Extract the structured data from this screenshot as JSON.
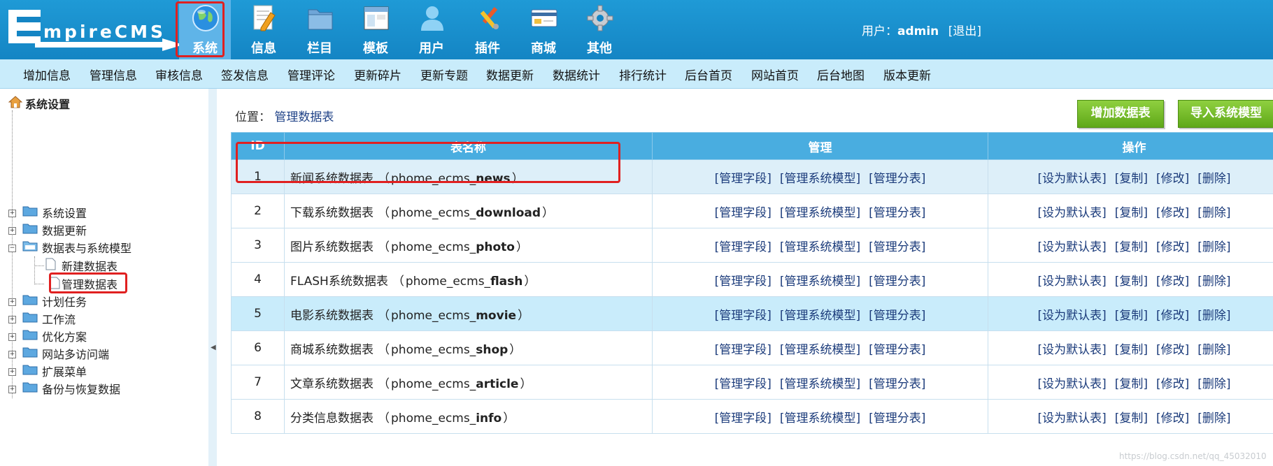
{
  "header": {
    "logo_text": "EmpireCMS",
    "nav": [
      {
        "label": "系统",
        "icon": "globe-icon",
        "active": true
      },
      {
        "label": "信息",
        "icon": "document-pen-icon"
      },
      {
        "label": "栏目",
        "icon": "folder-icon"
      },
      {
        "label": "模板",
        "icon": "window-template-icon"
      },
      {
        "label": "用户",
        "icon": "user-icon"
      },
      {
        "label": "插件",
        "icon": "plugin-tools-icon"
      },
      {
        "label": "商城",
        "icon": "card-shop-icon"
      },
      {
        "label": "其他",
        "icon": "gear-icon"
      }
    ],
    "user_label": "用户：",
    "username": "admin",
    "logout": "[退出]"
  },
  "subnav": [
    "增加信息",
    "管理信息",
    "审核信息",
    "签发信息",
    "管理评论",
    "更新碎片",
    "更新专题",
    "数据更新",
    "数据统计",
    "排行统计",
    "后台首页",
    "网站首页",
    "后台地图",
    "版本更新"
  ],
  "sidebar": {
    "root": "系统设置",
    "items": [
      {
        "label": "系统设置"
      },
      {
        "label": "数据更新"
      },
      {
        "label": "数据表与系统模型",
        "expanded": true,
        "children": [
          {
            "label": "新建数据表"
          },
          {
            "label": "管理数据表",
            "selected": true
          }
        ]
      },
      {
        "label": "计划任务"
      },
      {
        "label": "工作流"
      },
      {
        "label": "优化方案"
      },
      {
        "label": "网站多访问端"
      },
      {
        "label": "扩展菜单"
      },
      {
        "label": "备份与恢复数据"
      }
    ]
  },
  "main": {
    "breadcrumb_prefix": "位置：",
    "breadcrumb_link": "管理数据表",
    "buttons": {
      "add_table": "增加数据表",
      "import_model": "导入系统模型"
    },
    "table": {
      "headers": [
        "ID",
        "表名称",
        "管理",
        "操作"
      ],
      "manage_actions": [
        "[管理字段]",
        "[管理系统模型]",
        "[管理分表]"
      ],
      "op_actions": [
        "[设为默认表]",
        "[复制]",
        "[修改]",
        "[删除]"
      ],
      "rows": [
        {
          "id": "1",
          "name": "新闻系统数据表",
          "prefix": "phome_ecms_",
          "suffix": "news"
        },
        {
          "id": "2",
          "name": "下载系统数据表",
          "prefix": "phome_ecms_",
          "suffix": "download"
        },
        {
          "id": "3",
          "name": "图片系统数据表",
          "prefix": "phome_ecms_",
          "suffix": "photo"
        },
        {
          "id": "4",
          "name": "FLASH系统数据表",
          "prefix": "phome_ecms_",
          "suffix": "flash"
        },
        {
          "id": "5",
          "name": "电影系统数据表",
          "prefix": "phome_ecms_",
          "suffix": "movie"
        },
        {
          "id": "6",
          "name": "商城系统数据表",
          "prefix": "phome_ecms_",
          "suffix": "shop"
        },
        {
          "id": "7",
          "name": "文章系统数据表",
          "prefix": "phome_ecms_",
          "suffix": "article"
        },
        {
          "id": "8",
          "name": "分类信息数据表",
          "prefix": "phome_ecms_",
          "suffix": "info"
        }
      ]
    }
  },
  "watermark": "https://blog.csdn.net/qq_45032010"
}
